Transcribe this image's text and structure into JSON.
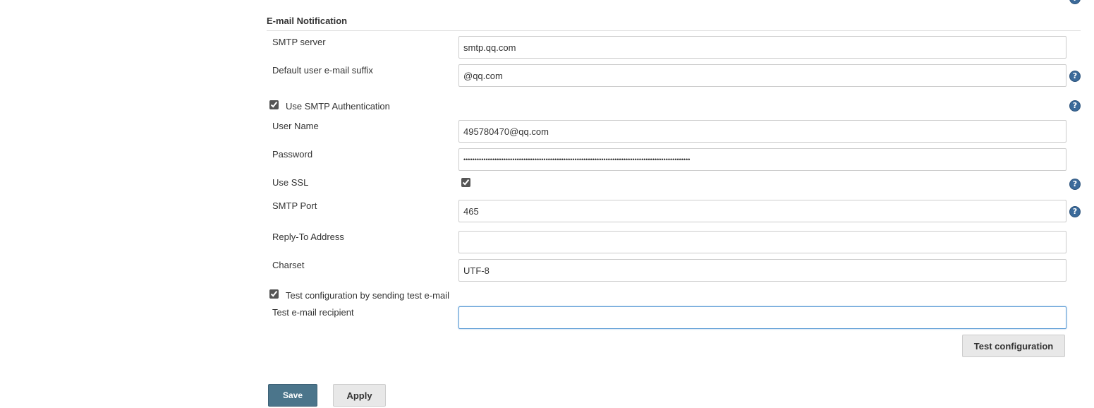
{
  "section": {
    "title": "E-mail Notification"
  },
  "fields": {
    "smtp_server": {
      "label": "SMTP server",
      "value": "smtp.qq.com"
    },
    "default_suffix": {
      "label": "Default user e-mail suffix",
      "value": "@qq.com"
    },
    "use_smtp_auth": {
      "label": "Use SMTP Authentication",
      "checked": true
    },
    "user_name": {
      "label": "User Name",
      "value": "495780470@qq.com"
    },
    "password": {
      "label": "Password",
      "value": "••••••••••••••••••••••••••••••••••••••••••••••••••••••••••••••••••••••••••••••••••••••••••••••••••••••"
    },
    "use_ssl": {
      "label": "Use SSL",
      "checked": true
    },
    "smtp_port": {
      "label": "SMTP Port",
      "value": "465"
    },
    "reply_to": {
      "label": "Reply-To Address",
      "value": ""
    },
    "charset": {
      "label": "Charset",
      "value": "UTF-8"
    },
    "test_config": {
      "label": "Test configuration by sending test e-mail",
      "checked": true
    },
    "test_recipient": {
      "label": "Test e-mail recipient",
      "value": ""
    }
  },
  "buttons": {
    "test_configuration": "Test configuration",
    "save": "Save",
    "apply": "Apply"
  },
  "icons": {
    "help": "help-icon",
    "help_glyph": "?"
  },
  "colors": {
    "save_button": "#4b758b",
    "help_icon": "#3b6a9a",
    "focus_border": "#5b9bd5"
  }
}
